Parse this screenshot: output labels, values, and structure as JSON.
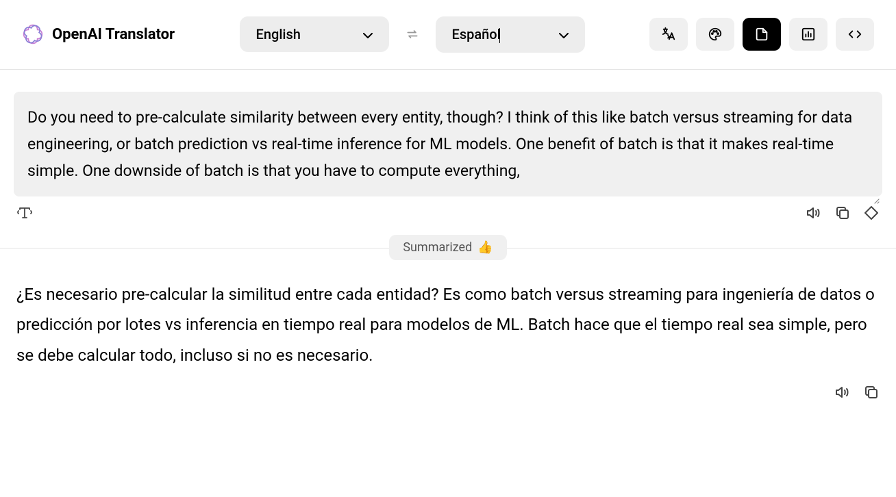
{
  "header": {
    "app_title": "OpenAI Translator",
    "source_lang": "English",
    "target_lang": "Español"
  },
  "input": {
    "text": "Do you need to pre-calculate similarity between every entity, though? I think of this like batch versus streaming for data engineering, or batch prediction vs real-time inference for ML models. One benefit of batch is that it makes real-time simple. One downside of batch is that you have to compute everything,"
  },
  "badge": {
    "label": "Summarized",
    "emoji": "👍"
  },
  "output": {
    "text": "¿Es necesario pre-calcular la similitud entre cada entidad? Es como batch versus streaming para ingeniería de datos o predicción por lotes vs inferencia en tiempo real para modelos de ML. Batch hace que el tiempo real sea simple, pero se debe calcular todo, incluso si no es necesario."
  }
}
